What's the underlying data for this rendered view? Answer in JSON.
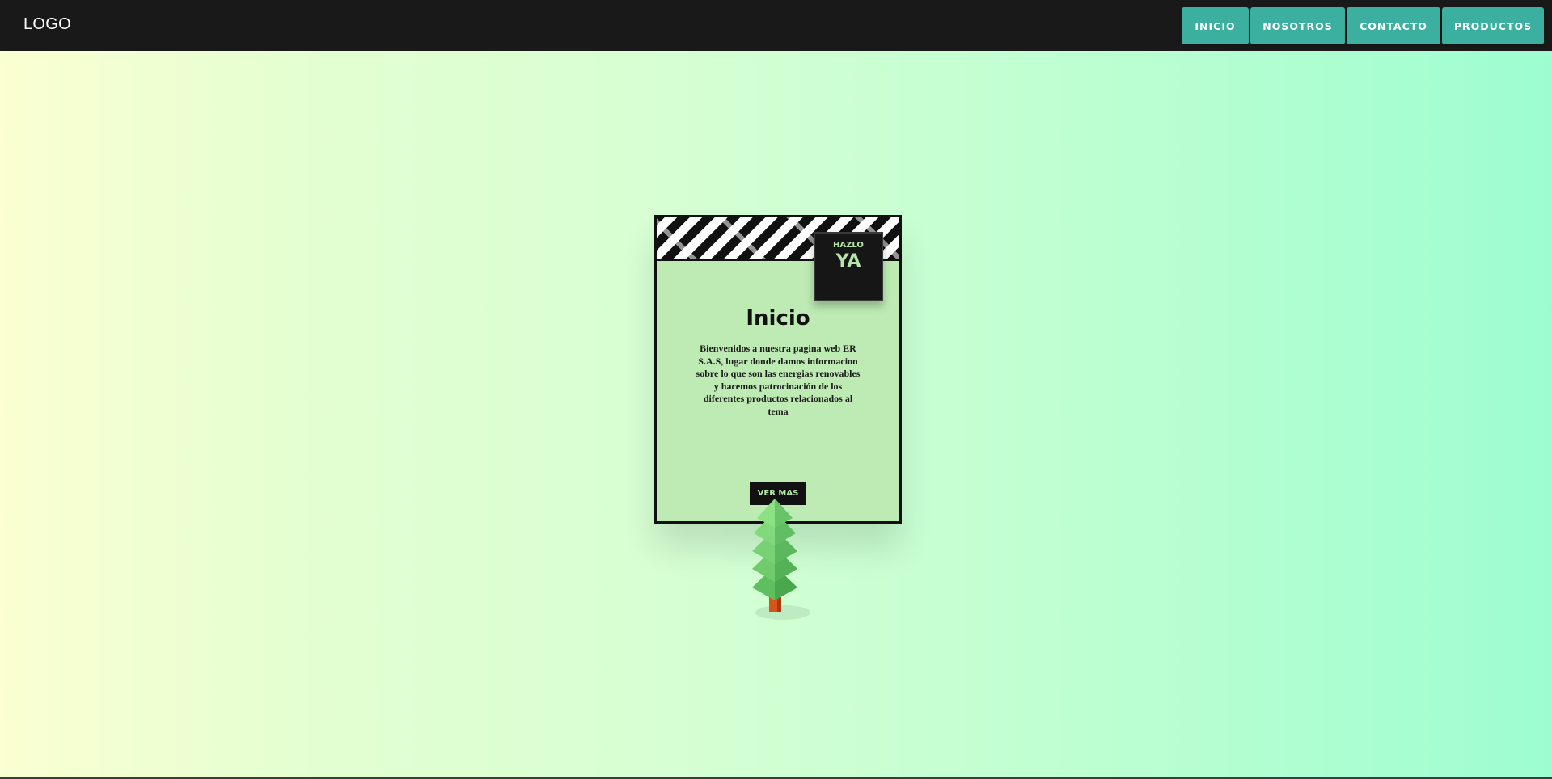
{
  "header": {
    "logo": "LOGO",
    "nav": [
      {
        "label": "INICIO"
      },
      {
        "label": "NOSOTROS"
      },
      {
        "label": "CONTACTO"
      },
      {
        "label": "PRODUCTOS"
      }
    ]
  },
  "card": {
    "badge_top": "HAZLO",
    "badge_main": "YA",
    "title": "Inicio",
    "text": "Bienvenidos a nuestra pagina web ER S.A.S, lugar donde damos informacion sobre lo que son las energias renovables y hacemos patrocinación de los diferentes productos relacionados al tema",
    "button": "VER MAS"
  },
  "icons": {
    "tree": "tree-illustration-icon"
  },
  "colors": {
    "topbar": "#191919",
    "nav_button": "#3bb0a1",
    "card_bg": "#bdebb3",
    "accent_text": "#b6e6aa"
  }
}
